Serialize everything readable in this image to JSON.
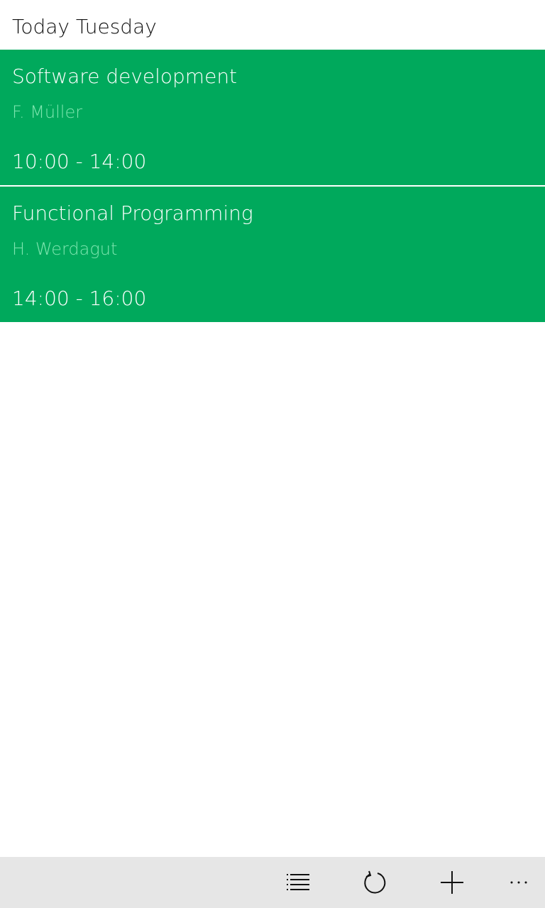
{
  "header": {
    "title": "Today Tuesday"
  },
  "lessons": [
    {
      "subject": "Software development",
      "teacher": "F. Müller",
      "time": "10:00 - 14:00"
    },
    {
      "subject": "Functional Programming",
      "teacher": "H. Werdagut",
      "time": "14:00 - 16:00"
    }
  ],
  "app_bar": {
    "buttons": [
      {
        "icon": "list-icon"
      },
      {
        "icon": "refresh-icon"
      },
      {
        "icon": "add-icon"
      },
      {
        "icon": "more-icon"
      }
    ]
  },
  "colors": {
    "card": "#00A95C",
    "card_secondary_text": "#7FE6B0",
    "app_bar": "#E6E6E6"
  }
}
